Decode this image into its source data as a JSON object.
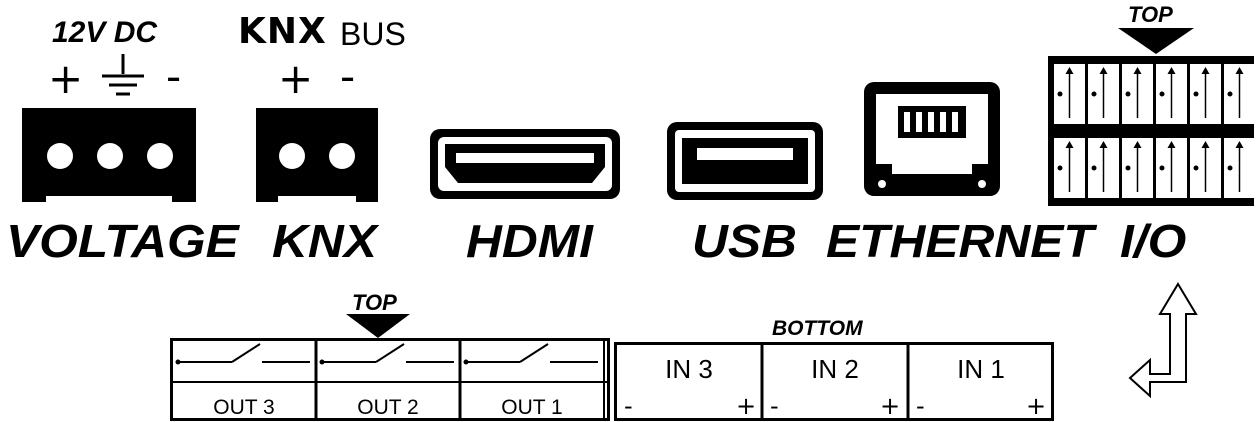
{
  "power": {
    "header": "12V DC",
    "plus": "+",
    "minus": "-",
    "label": "VOLTAGE"
  },
  "knx": {
    "logo": "KNX",
    "header_suffix": "BUS",
    "plus": "+",
    "minus": "-",
    "label": "KNX"
  },
  "hdmi": {
    "label": "HDMI"
  },
  "usb": {
    "label": "USB"
  },
  "ethernet": {
    "label": "ETHERNET"
  },
  "io": {
    "label": "I/O",
    "top_marker": "TOP"
  },
  "relay_block": {
    "top_marker": "TOP",
    "outputs": [
      "OUT 3",
      "OUT 2",
      "OUT 1"
    ]
  },
  "input_block": {
    "bottom_marker": "BOTTOM",
    "inputs": [
      {
        "label": "IN 3",
        "minus": "-",
        "plus": "+"
      },
      {
        "label": "IN 2",
        "minus": "-",
        "plus": "+"
      },
      {
        "label": "IN 1",
        "minus": "-",
        "plus": "+"
      }
    ]
  },
  "colors": {
    "ink": "#000000",
    "background": "#ffffff"
  }
}
